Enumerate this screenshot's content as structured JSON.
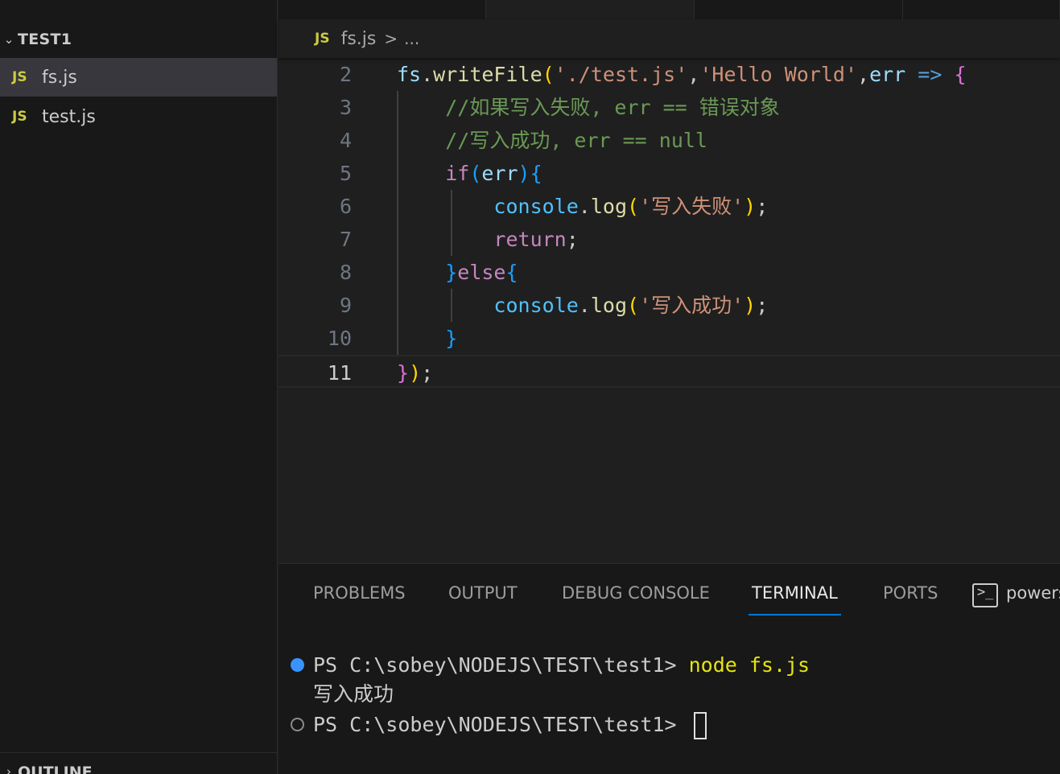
{
  "explorer": {
    "folder_name": "TEST1",
    "files": [
      {
        "icon": "JS",
        "name": "fs.js",
        "active": true
      },
      {
        "icon": "JS",
        "name": "test.js",
        "active": false
      }
    ],
    "outline_label": "OUTLINE"
  },
  "breadcrumb": {
    "icon": "JS",
    "file": "fs.js",
    "separator": ">",
    "more": "..."
  },
  "editor": {
    "current_line": 11,
    "lines": [
      {
        "n": "2",
        "text": "fs.writeFile('./test.js','Hello World',err => {"
      },
      {
        "n": "3",
        "text": "    //如果写入失败, err == 错误对象"
      },
      {
        "n": "4",
        "text": "    //写入成功, err == null"
      },
      {
        "n": "5",
        "text": "    if(err){"
      },
      {
        "n": "6",
        "text": "        console.log('写入失败');"
      },
      {
        "n": "7",
        "text": "        return;"
      },
      {
        "n": "8",
        "text": "    }else{"
      },
      {
        "n": "9",
        "text": "        console.log('写入成功');"
      },
      {
        "n": "10",
        "text": "    }"
      },
      {
        "n": "11",
        "text": "});"
      }
    ]
  },
  "panel": {
    "tabs": [
      "PROBLEMS",
      "OUTPUT",
      "DEBUG CONSOLE",
      "TERMINAL",
      "PORTS"
    ],
    "active_tab": "TERMINAL",
    "terminal_name": "powershell",
    "terminal": {
      "prompt1": "PS C:\\sobey\\NODEJS\\TEST\\test1> ",
      "command1": "node fs.js",
      "output1": "写入成功",
      "prompt2": "PS C:\\sobey\\NODEJS\\TEST\\test1> "
    }
  },
  "colors": {
    "accent": "#0078d4",
    "js_icon": "#cbcb41",
    "status_dot": "#3794ff"
  }
}
